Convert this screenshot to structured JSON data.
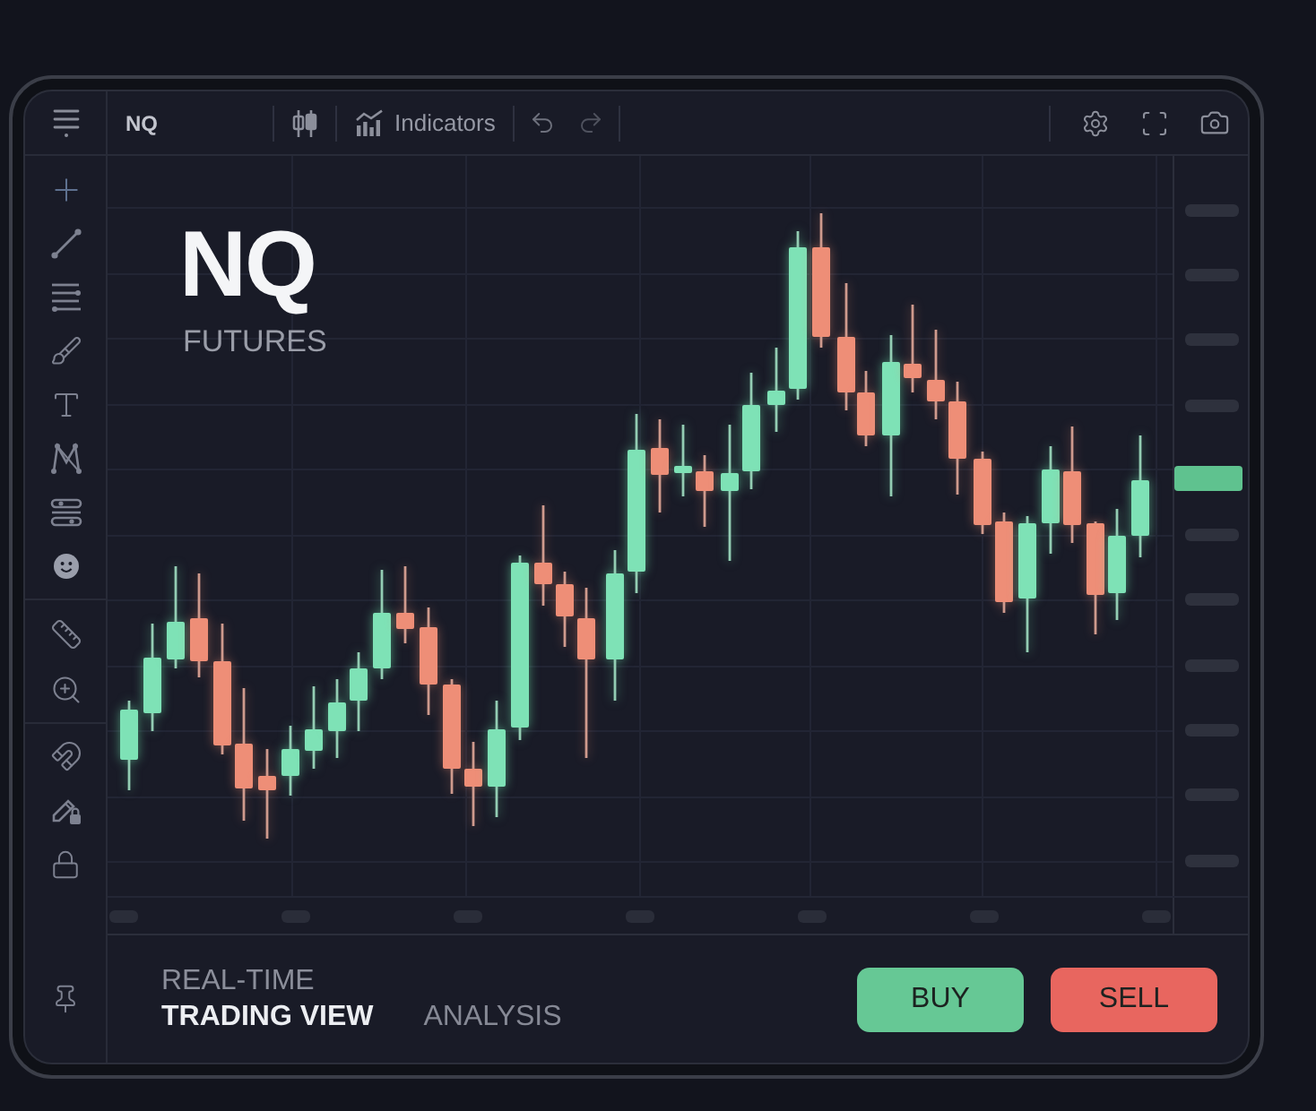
{
  "toolbar": {
    "symbol": "NQ",
    "indicators": "Indicators"
  },
  "chart": {
    "title": "NQ",
    "subtitle": "FUTURES"
  },
  "bottom_bar": {
    "caption": "REAL-TIME",
    "tabs": [
      {
        "label": "TRADING VIEW",
        "selected": true
      },
      {
        "label": "ANALYSIS",
        "selected": false
      }
    ],
    "buttons": [
      {
        "label": "BUY",
        "kind": "buy"
      },
      {
        "label": "SELL",
        "kind": "sell"
      }
    ]
  }
}
